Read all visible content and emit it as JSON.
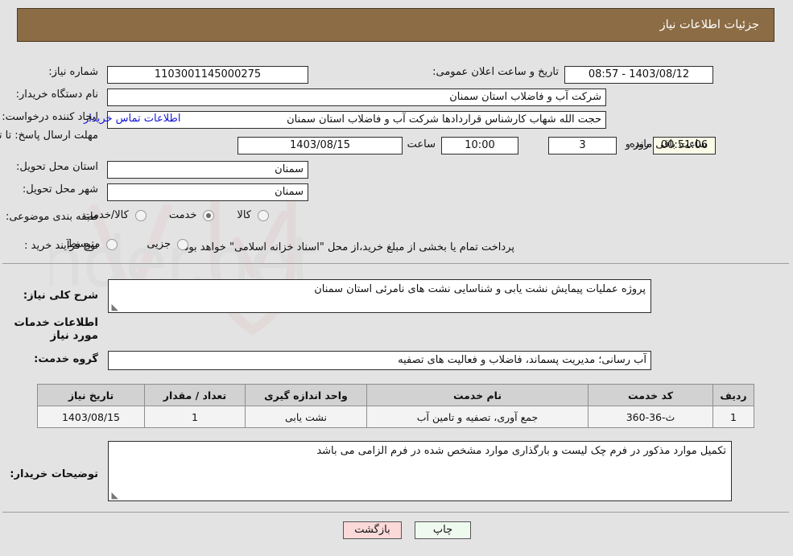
{
  "header": {
    "title": "جزئیات اطلاعات نیاز"
  },
  "top_form": {
    "need_number_label": "شماره نیاز:",
    "need_number_value": "1103001145000275",
    "public_announce_label": "تاریخ و ساعت اعلان عمومی:",
    "public_announce_value": "1403/08/12 - 08:57",
    "buyer_org_label": "نام دستگاه خریدار:",
    "buyer_org_value": "شرکت آب و فاضلاب استان سمنان",
    "requester_label": "ایجاد کننده درخواست:",
    "requester_value": "حجت الله شهاب کارشناس قراردادها شرکت آب و فاضلاب استان سمنان",
    "contact_link": "اطلاعات تماس خریدار",
    "deadline_label": "مهلت ارسال پاسخ: تا تاریخ:",
    "deadline_date": "1403/08/15",
    "hour_label": "ساعت",
    "deadline_time": "10:00",
    "days_value": "3",
    "days_label": "روز و",
    "countdown_value": "00:51:06",
    "remaining_label": "ساعت باقی مانده",
    "province_label": "استان محل تحویل:",
    "province_value": "سمنان",
    "city_label": "شهر محل تحویل:",
    "city_value": "سمنان",
    "classification_label": "طبقه بندی موضوعی:",
    "classification_options": [
      {
        "label": "کالا",
        "selected": false
      },
      {
        "label": "خدمت",
        "selected": true
      },
      {
        "label": "کالا/خدمت",
        "selected": false
      }
    ],
    "process_type_label": "نوع فرآیند خرید :",
    "process_type_options": [
      {
        "label": "جزیی",
        "selected": false
      },
      {
        "label": "متوسط",
        "selected": false
      }
    ],
    "treasury_note": "پرداخت تمام یا بخشی از مبلغ خرید،از محل \"اسناد خزانه اسلامی\" خواهد بود."
  },
  "summary": {
    "label": "شرح کلی نیاز:",
    "value": "پروژه عملیات پیمایش نشت یابی و شناسایی نشت های نامرئی استان سمنان"
  },
  "services_section": {
    "heading": "اطلاعات خدمات مورد نیاز",
    "group_label": "گروه خدمت:",
    "group_value": "آب رسانی؛ مدیریت پسماند، فاضلاب و فعالیت های تصفیه",
    "table": {
      "columns": [
        "ردیف",
        "کد خدمت",
        "نام خدمت",
        "واحد اندازه گیری",
        "تعداد / مقدار",
        "تاریخ نیاز"
      ],
      "rows": [
        {
          "row_no": "1",
          "service_code": "ث-36-360",
          "service_name": "جمع آوری، تصفیه و تامین آب",
          "unit": "نشت یابی",
          "quantity": "1",
          "need_date": "1403/08/15"
        }
      ]
    }
  },
  "buyer_notes": {
    "label": "توضیحات خریدار:",
    "value": "تکمیل موارد مذکور در فرم چک لیست و بارگذاری موارد مشخص شده در فرم الزامی می باشد"
  },
  "footer": {
    "print_label": "چاپ",
    "back_label": "بازگشت"
  },
  "watermark": {
    "text": "AriaTender.net"
  },
  "colors": {
    "header_bg": "#8b6c45",
    "page_bg": "#e3e3e3",
    "link": "#1414d8",
    "countdown_bg": "#fbfbe8",
    "back_btn_bg": "#fbd9d9",
    "print_btn_bg": "#effaef",
    "table_header_bg": "#d2d2d2"
  }
}
